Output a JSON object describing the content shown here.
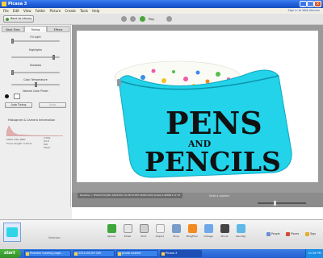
{
  "window": {
    "title": "Picasa 3",
    "controls": [
      "_",
      "□",
      "×"
    ]
  },
  "menu": {
    "items": [
      "File",
      "Edit",
      "View",
      "Folder",
      "Picture",
      "Create",
      "Tools",
      "Help"
    ],
    "sign_in": "Sign in to Web Albums"
  },
  "toolbar": {
    "back_label": "Back to Library",
    "play_label": "Play"
  },
  "panel": {
    "tabs": [
      "Basic Fixes",
      "Tuning",
      "Effects"
    ],
    "active_tab": "Tuning",
    "sliders": [
      {
        "label": "Fill Light",
        "value": 0.0
      },
      {
        "label": "Highlights",
        "value": 0.85
      },
      {
        "label": "Shadows",
        "value": 0.0
      },
      {
        "label": "Color Temperature",
        "value": 0.5
      }
    ],
    "neutral_label": "Neutral Color Picker",
    "buttons": {
      "auto_tuning": "Auto Tuning",
      "undo": "Undo"
    },
    "histogram_title": "Histogram & Camera Information",
    "camera": {
      "model": "SONY DSC-W80",
      "focal": "Focal Length: 5.8mm",
      "right": [
        "1/30s",
        "f/2.8",
        "ISO",
        "Flash"
      ]
    }
  },
  "viewer": {
    "pouch_text_1": "PENS",
    "pouch_text_2": "AND",
    "pouch_text_3": "PENCILS",
    "caption_placeholder": "Make a caption!",
    "info": "Desktop > DSC01234.JPG   4/6/2009 10:38:23 PM   1600x1200 pixels   0.99MB   2 of 13"
  },
  "tray": {
    "selection_label": "Selection",
    "tools": [
      "Upload",
      "Email",
      "Print",
      "Export",
      "Shop",
      "BlogThis!",
      "Collage",
      "Movie",
      "Geo-Tag"
    ],
    "right_buttons": [
      "People",
      "Places",
      "Tags"
    ]
  },
  "taskbar": {
    "start": "start",
    "tasks": [
      "Problem loading page...",
      "2010-06-09 005",
      "photo hosted",
      "Picasa 3"
    ],
    "clock": "10:38 PM"
  },
  "colors": {
    "pouch": "#22d3ea",
    "accent": "#245fd0",
    "start": "#3f9f34"
  }
}
